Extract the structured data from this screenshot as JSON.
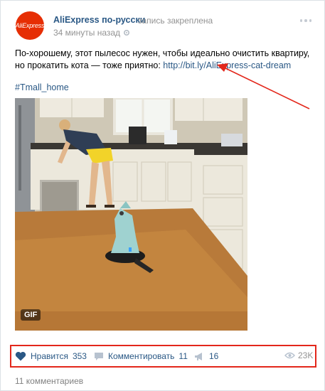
{
  "post": {
    "author": "AliExpress по-русски",
    "avatar_text": "AliExpress",
    "pinned_label": "запись закреплена",
    "time": "34 минуты назад",
    "text_before_link": "По-хорошему, этот пылесос нужен, чтобы идеально очистить квартиру, но прокатить кота — тоже приятно: ",
    "link": "http://bit.ly/AliExpress-cat-dream",
    "hashtag": "#Tmall_home",
    "gif_badge": "GIF"
  },
  "actions": {
    "like_label": "Нравится",
    "like_count": "353",
    "comment_label": "Комментировать",
    "comment_count": "11",
    "share_count": "16",
    "views": "23K"
  },
  "footer": {
    "comments_total": "11 комментариев"
  },
  "colors": {
    "accent_link": "#2a5885",
    "highlight_red": "#e3271b",
    "brand": "#e62e04"
  }
}
